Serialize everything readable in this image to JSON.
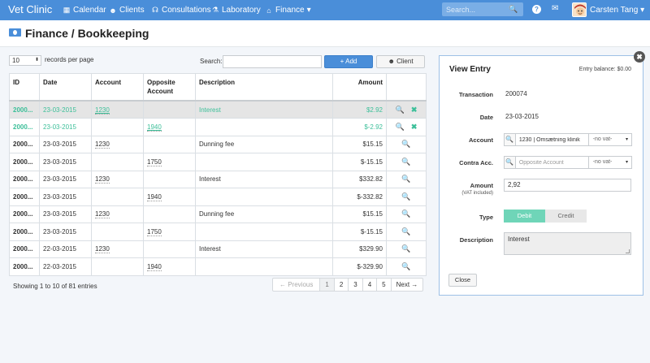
{
  "navbar": {
    "brand": "Vet Clinic",
    "items": [
      {
        "label": "Calendar",
        "icon": "calendar-icon",
        "glyph": "▦"
      },
      {
        "label": "Clients",
        "icon": "users-icon",
        "glyph": "☻"
      },
      {
        "label": "Consultations",
        "icon": "stethoscope-icon",
        "glyph": "☊"
      },
      {
        "label": "Laboratory",
        "icon": "flask-icon",
        "glyph": "⚗"
      },
      {
        "label": "Finance",
        "icon": "bank-icon",
        "glyph": "⌂"
      }
    ],
    "finance_caret": "▾",
    "search_placeholder": "Search...",
    "search_glyph": "🔍",
    "help_glyph": "?",
    "mail_glyph": "✉",
    "user_name": "Carsten Tang",
    "user_caret": "▾"
  },
  "page": {
    "title": "Finance / Bookkeeping"
  },
  "controls": {
    "records_value": "10",
    "records_label": "records per page",
    "search_label": "Search:",
    "add_label": "+ Add",
    "client_label": "☻ Client"
  },
  "table": {
    "headers": [
      "ID",
      "Date",
      "Account",
      "Opposite Account",
      "Description",
      "Amount"
    ],
    "rows": [
      {
        "id": "2000...",
        "date": "23-03-2015",
        "account": "1230",
        "opposite": "",
        "description": "Interest",
        "amount": "$2.92"
      },
      {
        "id": "2000...",
        "date": "23-03-2015",
        "account": "",
        "opposite": "1940",
        "description": "",
        "amount": "$-2.92"
      },
      {
        "id": "2000...",
        "date": "23-03-2015",
        "account": "1230",
        "opposite": "",
        "description": "Dunning fee",
        "amount": "$15.15"
      },
      {
        "id": "2000...",
        "date": "23-03-2015",
        "account": "",
        "opposite": "1750",
        "description": "",
        "amount": "$-15.15"
      },
      {
        "id": "2000...",
        "date": "23-03-2015",
        "account": "1230",
        "opposite": "",
        "description": "Interest",
        "amount": "$332.82"
      },
      {
        "id": "2000...",
        "date": "23-03-2015",
        "account": "",
        "opposite": "1940",
        "description": "",
        "amount": "$-332.82"
      },
      {
        "id": "2000...",
        "date": "23-03-2015",
        "account": "1230",
        "opposite": "",
        "description": "Dunning fee",
        "amount": "$15.15"
      },
      {
        "id": "2000...",
        "date": "23-03-2015",
        "account": "",
        "opposite": "1750",
        "description": "",
        "amount": "$-15.15"
      },
      {
        "id": "2000...",
        "date": "22-03-2015",
        "account": "1230",
        "opposite": "",
        "description": "Interest",
        "amount": "$329.90"
      },
      {
        "id": "2000...",
        "date": "22-03-2015",
        "account": "",
        "opposite": "1940",
        "description": "",
        "amount": "$-329.90"
      }
    ],
    "view_glyph": "🔍",
    "delete_glyph": "✖",
    "highlight_color": "#3cbf99"
  },
  "footer": {
    "showing": "Showing 1 to 10 of 81 entries",
    "pager": {
      "previous": "← Previous",
      "pages": [
        "1",
        "2",
        "3",
        "4",
        "5"
      ],
      "next": "Next →"
    }
  },
  "entry": {
    "title": "View Entry",
    "balance": "Entry balance: $0.00",
    "close_glyph": "✖",
    "transaction_label": "Transaction",
    "transaction": "200074",
    "date_label": "Date",
    "date": "23-03-2015",
    "account_label": "Account",
    "account": "1230 | Omsætning klinik",
    "account_vat": "-no vat-",
    "contra_label": "Contra Acc.",
    "contra_placeholder": "Opposite Account",
    "contra_vat": "-no vat-",
    "amount_label": "Amount",
    "amount_sub": "(VAT included)",
    "amount": "2,92",
    "type_label": "Type",
    "type_debit": "Debit",
    "type_credit": "Credit",
    "description_label": "Description",
    "description": "Interest",
    "close_button": "Close"
  }
}
